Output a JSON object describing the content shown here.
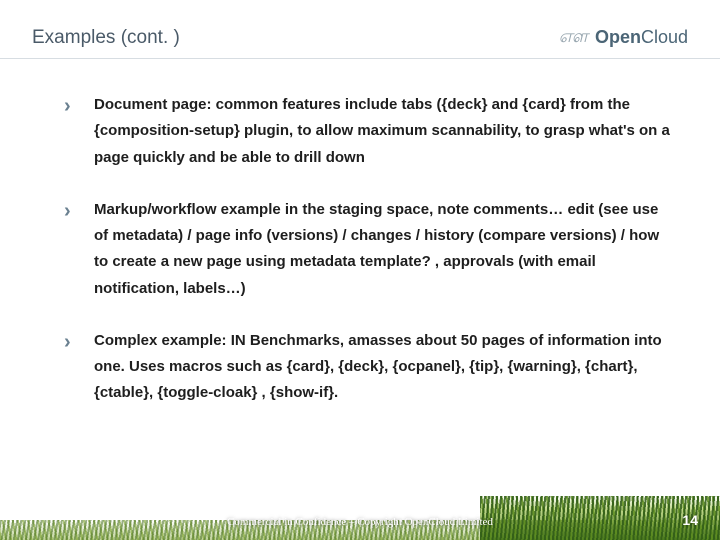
{
  "header": {
    "title": "Examples (cont. )",
    "brand_name_strong": "Open",
    "brand_name_light": "Cloud"
  },
  "bullets": [
    "Document page: common features include tabs ({deck} and {card} from the {composition-setup} plugin, to allow maximum scannability, to grasp what's on a page quickly and be able to drill down",
    "Markup/workflow example in the staging space, note comments… edit  (see use of metadata) / page info (versions) / changes / history (compare versions) / how to create a new page using metadata template? , approvals (with email notification, labels…)",
    "Complex example: IN Benchmarks, amasses about 50 pages of information into one. Uses macros such as {card}, {deck}, {ocpanel}, {tip}, {warning}, {chart}, {ctable}, {toggle-cloak} , {show-if}."
  ],
  "footer": {
    "confidential": "Commercial in Confidence – Copyright OpenCloud Limited",
    "page_number": "14"
  }
}
